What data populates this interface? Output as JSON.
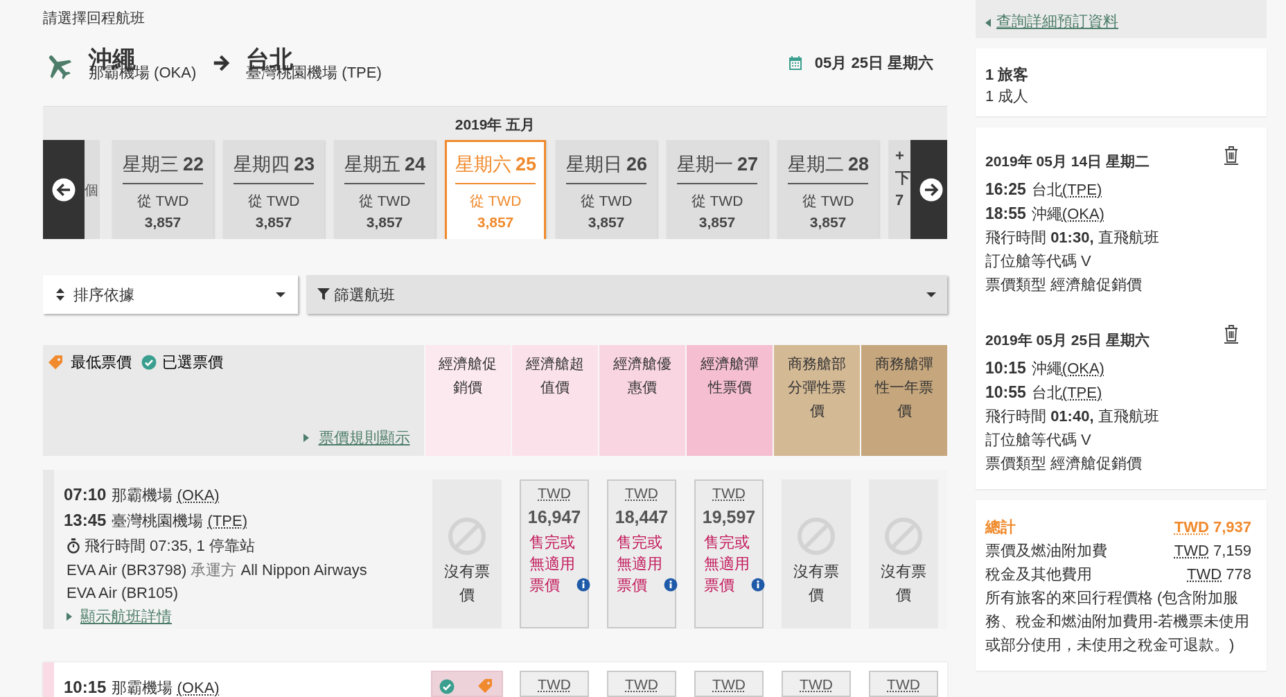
{
  "heading": "請選擇回程航班",
  "route": {
    "from_city": "沖繩",
    "from_airport": "那霸機場 (OKA)",
    "to_city": "台北",
    "to_airport": "臺灣桃園機場 (TPE)",
    "date": "05月 25日 星期六"
  },
  "date_strip": {
    "month": "2019年 五月",
    "prev_partial": "個",
    "next_partial": [
      "+",
      "下",
      "7"
    ],
    "days": [
      {
        "weekday": "星期三",
        "date": "22",
        "from": "從 TWD",
        "price": "3,857",
        "selected": false
      },
      {
        "weekday": "星期四",
        "date": "23",
        "from": "從 TWD",
        "price": "3,857",
        "selected": false
      },
      {
        "weekday": "星期五",
        "date": "24",
        "from": "從 TWD",
        "price": "3,857",
        "selected": false
      },
      {
        "weekday": "星期六",
        "date": "25",
        "from": "從 TWD",
        "price": "3,857",
        "selected": true
      },
      {
        "weekday": "星期日",
        "date": "26",
        "from": "從 TWD",
        "price": "3,857",
        "selected": false
      },
      {
        "weekday": "星期一",
        "date": "27",
        "from": "從 TWD",
        "price": "3,857",
        "selected": false
      },
      {
        "weekday": "星期二",
        "date": "28",
        "from": "從 TWD",
        "price": "3,857",
        "selected": false
      }
    ]
  },
  "sort": {
    "label": "排序依據"
  },
  "filter": {
    "label": "篩選航班"
  },
  "legend": [
    {
      "kind": "lowest",
      "label": "最低票價"
    },
    {
      "kind": "selected",
      "label": "已選票價"
    }
  ],
  "fare_rules_link": "票價規則顯示",
  "fare_columns": [
    {
      "label": "經濟艙促銷價",
      "color": "#fce9ef"
    },
    {
      "label": "經濟艙超值價",
      "color": "#fbe2ea"
    },
    {
      "label": "經濟艙優惠價",
      "color": "#f9d5e1"
    },
    {
      "label": "經濟艙彈性票價",
      "color": "#f6bfd1"
    },
    {
      "label": "商務艙部分彈性票價",
      "color": "#d4b995"
    },
    {
      "label": "商務艙彈性一年票價",
      "color": "#c5a67d"
    }
  ],
  "flights": [
    {
      "selected": false,
      "depart_time": "07:10",
      "depart_airport": "那霸機場",
      "depart_code": "(OKA)",
      "arrive_time": "13:45",
      "arrive_airport": "臺灣桃園機場",
      "arrive_code": "(TPE)",
      "duration": "飛行時間 07:35, 1 停靠站",
      "segments": [
        {
          "flight": "EVA Air (BR3798)",
          "operated_label": "承運方",
          "operator": "All Nippon Airways"
        },
        {
          "flight": "EVA Air (BR105)"
        }
      ],
      "details_link": "顯示航班詳情",
      "fares": [
        {
          "kind": "none",
          "text": "沒有票價"
        },
        {
          "kind": "soldout",
          "currency": "TWD",
          "price": "16,947",
          "note": "售完或無適用票價"
        },
        {
          "kind": "soldout",
          "currency": "TWD",
          "price": "18,447",
          "note": "售完或無適用票價"
        },
        {
          "kind": "soldout",
          "currency": "TWD",
          "price": "19,597",
          "note": "售完或無適用票價"
        },
        {
          "kind": "none",
          "text": "沒有票價"
        },
        {
          "kind": "none",
          "text": "沒有票價"
        }
      ]
    },
    {
      "selected": true,
      "depart_time": "10:15",
      "depart_airport": "那霸機場",
      "depart_code": "(OKA)",
      "fares": [
        {
          "kind": "chosen"
        },
        {
          "kind": "price",
          "currency": "TWD"
        },
        {
          "kind": "price",
          "currency": "TWD"
        },
        {
          "kind": "price",
          "currency": "TWD"
        },
        {
          "kind": "price",
          "currency": "TWD"
        },
        {
          "kind": "price",
          "currency": "TWD"
        }
      ]
    }
  ],
  "sidebar": {
    "details_link": "查詢詳細預訂資料",
    "travellers": "1 旅客",
    "adults": "1 成人",
    "segments": [
      {
        "date": "2019年 05月 14日 星期二",
        "depart_time": "16:25",
        "depart_city": "台北",
        "depart_code": "(TPE)",
        "arrive_time": "18:55",
        "arrive_city": "沖繩",
        "arrive_code": "(OKA)",
        "duration": "飛行時間 **01:30,** 直飛航班",
        "booking_class": "訂位艙等代碼 V",
        "fare_type": "票價類型 經濟艙促銷價"
      },
      {
        "date": "2019年 05月 25日 星期六",
        "depart_time": "10:15",
        "depart_city": "沖繩",
        "depart_code": "(OKA)",
        "arrive_time": "10:55",
        "arrive_city": "台北",
        "arrive_code": "(TPE)",
        "duration": "飛行時間 **01:40,** 直飛航班",
        "booking_class": "訂位艙等代碼 V",
        "fare_type": "票價類型 經濟艙促銷價"
      }
    ],
    "total": {
      "label": "總計",
      "currency": "TWD",
      "amount": "7,937",
      "lines": [
        {
          "label": "票價及燃油附加費",
          "currency": "TWD",
          "amount": "7,159"
        },
        {
          "label": "稅金及其他費用",
          "currency": "TWD",
          "amount": "778"
        }
      ],
      "note": "所有旅客的來回行程價格 (包含附加服務、稅金和燃油附加費用-若機票未使用或部分使用，未使用之稅金可退款。)"
    }
  }
}
